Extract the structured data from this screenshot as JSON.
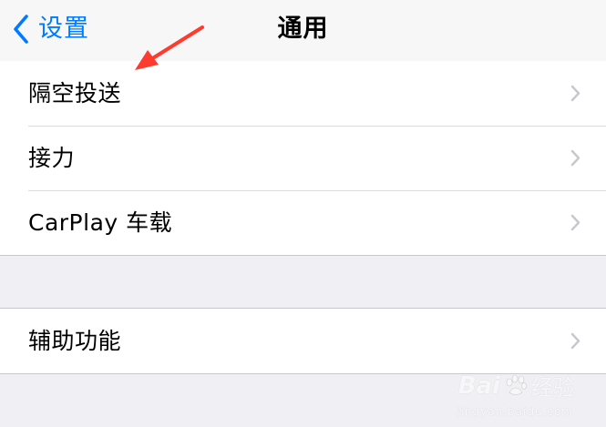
{
  "navbar": {
    "back_label": "设置",
    "title": "通用"
  },
  "groups": [
    {
      "items": [
        {
          "label": "隔空投送"
        },
        {
          "label": "接力"
        },
        {
          "label": "CarPlay 车载"
        }
      ]
    },
    {
      "items": [
        {
          "label": "辅助功能"
        }
      ]
    }
  ],
  "watermark": {
    "brand": "Bai",
    "sub": "经验",
    "url": "jingyan.baidu.com"
  },
  "colors": {
    "accent": "#007aff",
    "background": "#efeff4",
    "annotation_arrow": "#ff3b30"
  }
}
